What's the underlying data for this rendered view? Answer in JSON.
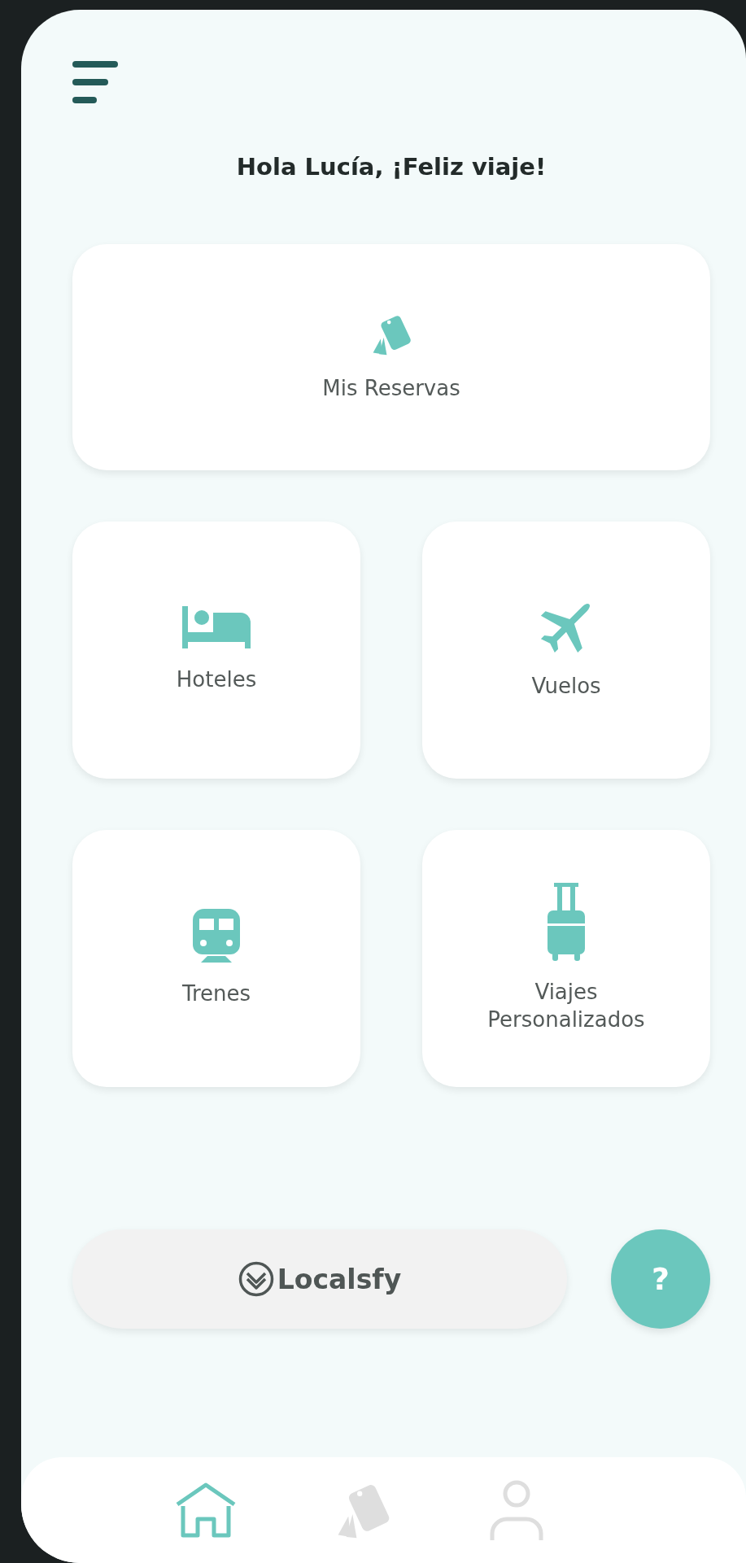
{
  "greeting": "Hola Lucía, ¡Feliz viaje!",
  "cards": [
    {
      "kind": "bookings",
      "label": "Mis Reservas"
    },
    {
      "kind": "hotel",
      "label": "Hoteles"
    },
    {
      "kind": "flight",
      "label": "Vuelos"
    },
    {
      "kind": "train",
      "label": "Trenes"
    },
    {
      "kind": "luggage",
      "label": "Viajes Personalizados"
    }
  ],
  "brand_button": {
    "label": "Localsfy"
  },
  "help_button": {
    "label": "?"
  },
  "bottom_nav": [
    {
      "kind": "home",
      "selected": true
    },
    {
      "kind": "bookings",
      "selected": false
    },
    {
      "kind": "profile",
      "selected": false
    }
  ]
}
